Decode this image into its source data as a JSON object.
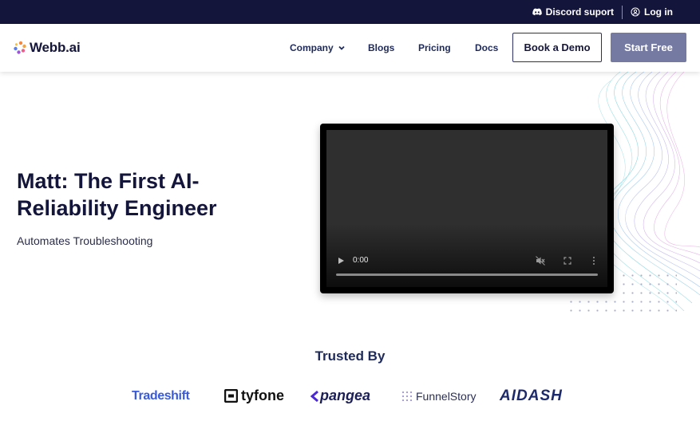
{
  "topbar": {
    "discord_label": "Discord suport",
    "login_label": "Log in"
  },
  "nav": {
    "logo_text": "Webb.ai",
    "company_label": "Company",
    "blogs_label": "Blogs",
    "pricing_label": "Pricing",
    "docs_label": "Docs",
    "demo_label": "Book a Demo",
    "start_label": "Start Free"
  },
  "hero": {
    "title": "Matt: The First AI-Reliability Engineer",
    "subtitle": "Automates Troubleshooting"
  },
  "video": {
    "time": "0:00",
    "progress": 0
  },
  "trusted": {
    "heading": "Trusted By",
    "logos": [
      "Tradeshift",
      "tyfone",
      "pangea",
      "FunnelStory",
      "AIDASH"
    ]
  },
  "colors": {
    "topbar_bg": "#14153a",
    "start_button": "#757aa3",
    "heading_navy": "#14153a",
    "logo_orange": "#f5883d",
    "tradeshift_blue": "#3a5bd9",
    "pangea_purple": "#4b2bd1",
    "aidash_navy": "#1d2a6b"
  }
}
